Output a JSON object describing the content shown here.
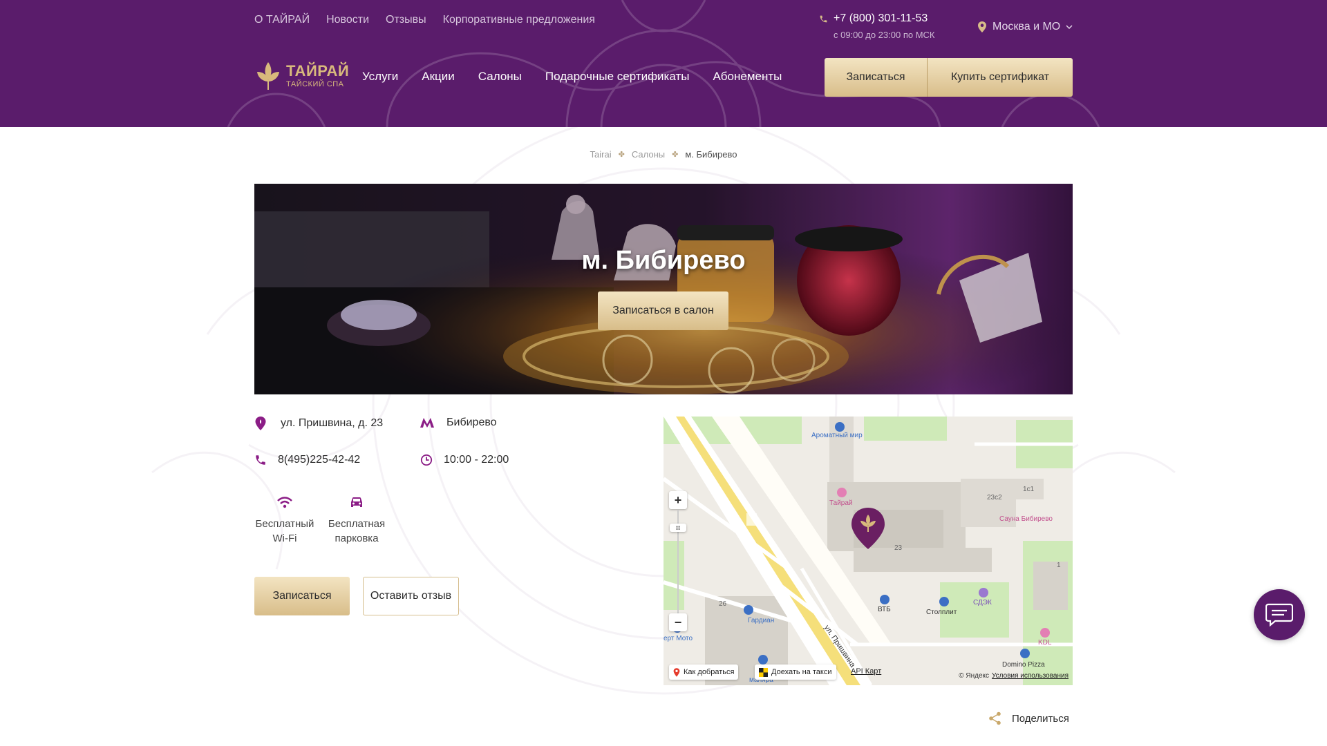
{
  "colors": {
    "brand_purple": "#5a1c6b",
    "gold": "#d8bd89",
    "accent_purple": "#8b1d86"
  },
  "topnav": [
    "О ТАЙРАЙ",
    "Новости",
    "Отзывы",
    "Корпоративные предложения"
  ],
  "contact": {
    "phone": "+7 (800) 301-11-53",
    "hours": "с 09:00 до 23:00 по МСК"
  },
  "region": {
    "label": "Москва и МО"
  },
  "logo": {
    "name": "ТАЙРАЙ",
    "tagline": "ТАЙСКИЙ СПА"
  },
  "mainnav": [
    "Услуги",
    "Акции",
    "Салоны",
    "Подарочные сертификаты",
    "Абонементы"
  ],
  "header_buttons": {
    "book": "Записаться",
    "certificate": "Купить сертификат"
  },
  "breadcrumb": [
    "Tairai",
    "Салоны",
    "м. Бибирево"
  ],
  "hero": {
    "title": "м. Бибирево",
    "button": "Записаться в салон"
  },
  "salon": {
    "address": "ул. Пришвина, д. 23",
    "metro": "Бибирево",
    "phone": "8(495)225-42-42",
    "hours": "10:00 - 22:00",
    "amenities": [
      {
        "icon": "wifi-icon",
        "line1": "Бесплатный",
        "line2": "Wi-Fi"
      },
      {
        "icon": "car-icon",
        "line1": "Бесплатная",
        "line2": "парковка"
      }
    ],
    "book_button": "Записаться",
    "review_button": "Оставить отзыв"
  },
  "map": {
    "labels": {
      "aroma": "Ароматный мир",
      "tairai": "Тайрай",
      "sauna": "Сауна Бибирево",
      "b23c2": "23с2",
      "b1c1": "1с1",
      "b23": "23",
      "vtb": "ВТБ",
      "stolplit": "Столплит",
      "sdek": "СДЭК",
      "gardian": "Гардиан",
      "b26": "26",
      "moto": "ерт Мото",
      "street": "ул. Пришвина",
      "kdl": "KDL",
      "domino": "Domino Pizza",
      "one": "1",
      "malyara": "маляра"
    },
    "route_button": "Как добраться",
    "taxi_button": "Доехать на такси",
    "api_link": "API Карт",
    "copyright": "© Яндекс",
    "terms": "Условия использования",
    "zoom_in": "+",
    "zoom_out": "−"
  },
  "share": {
    "label": "Поделиться"
  }
}
